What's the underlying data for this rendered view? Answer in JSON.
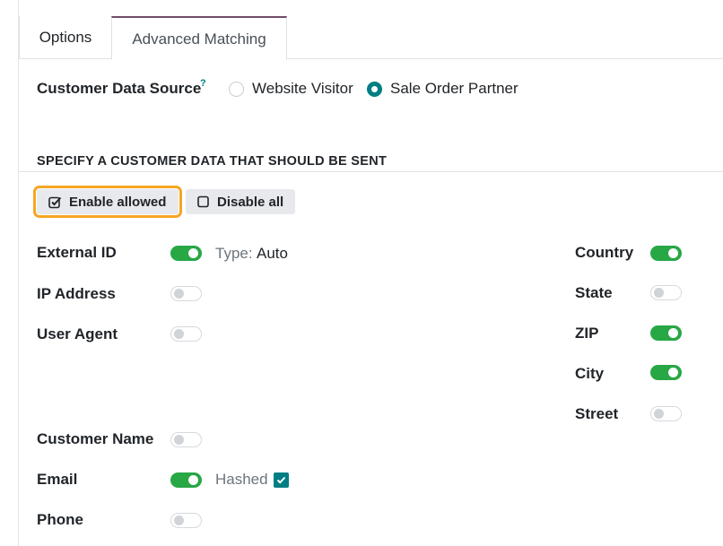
{
  "tabs": [
    {
      "label": "Options",
      "active": false
    },
    {
      "label": "Advanced Matching",
      "active": true
    }
  ],
  "data_source": {
    "label": "Customer Data Source",
    "help_mark": "?",
    "options": [
      {
        "label": "Website Visitor",
        "checked": false
      },
      {
        "label": "Sale Order Partner",
        "checked": true
      }
    ]
  },
  "section": {
    "title": "SPECIFY A CUSTOMER DATA THAT SHOULD BE SENT"
  },
  "buttons": {
    "enable_allowed": "Enable allowed",
    "disable_all": "Disable all"
  },
  "fields_left": {
    "external_id": {
      "label": "External ID",
      "on": true,
      "type_label": "Type:",
      "type_value": "Auto"
    },
    "ip_address": {
      "label": "IP Address",
      "on": false
    },
    "user_agent": {
      "label": "User Agent",
      "on": false
    },
    "customer_name": {
      "label": "Customer Name",
      "on": false
    },
    "email": {
      "label": "Email",
      "on": true,
      "hashed_label": "Hashed",
      "hashed": true
    },
    "phone": {
      "label": "Phone",
      "on": false
    }
  },
  "fields_right": {
    "country": {
      "label": "Country",
      "on": true
    },
    "state": {
      "label": "State",
      "on": false
    },
    "zip": {
      "label": "ZIP",
      "on": true
    },
    "city": {
      "label": "City",
      "on": true
    },
    "street": {
      "label": "Street",
      "on": false
    }
  },
  "colors": {
    "accent": "#017e84",
    "toggle_on": "#28a745",
    "tab_active_border": "#714b67",
    "highlight": "#f5a623"
  }
}
